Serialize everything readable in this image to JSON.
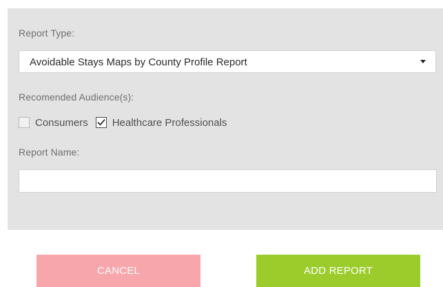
{
  "form": {
    "report_type_label": "Report Type:",
    "report_type_value": "Avoidable Stays Maps by County Profile Report",
    "audience_label": "Recomended Audience(s):",
    "audience_options": [
      {
        "label": "Consumers",
        "checked": false
      },
      {
        "label": "Healthcare Professionals",
        "checked": true
      }
    ],
    "report_name_label": "Report Name:",
    "report_name_value": "",
    "report_name_placeholder": ""
  },
  "buttons": {
    "cancel_label": "CANCEL",
    "add_label": "ADD REPORT"
  },
  "colors": {
    "panel_bg": "#e3e3e3",
    "cancel_bg": "#f7a6ab",
    "add_bg": "#9ccc2c"
  },
  "icons": {
    "select_caret": "caret-down-icon",
    "check_mark": "checkmark-icon"
  }
}
